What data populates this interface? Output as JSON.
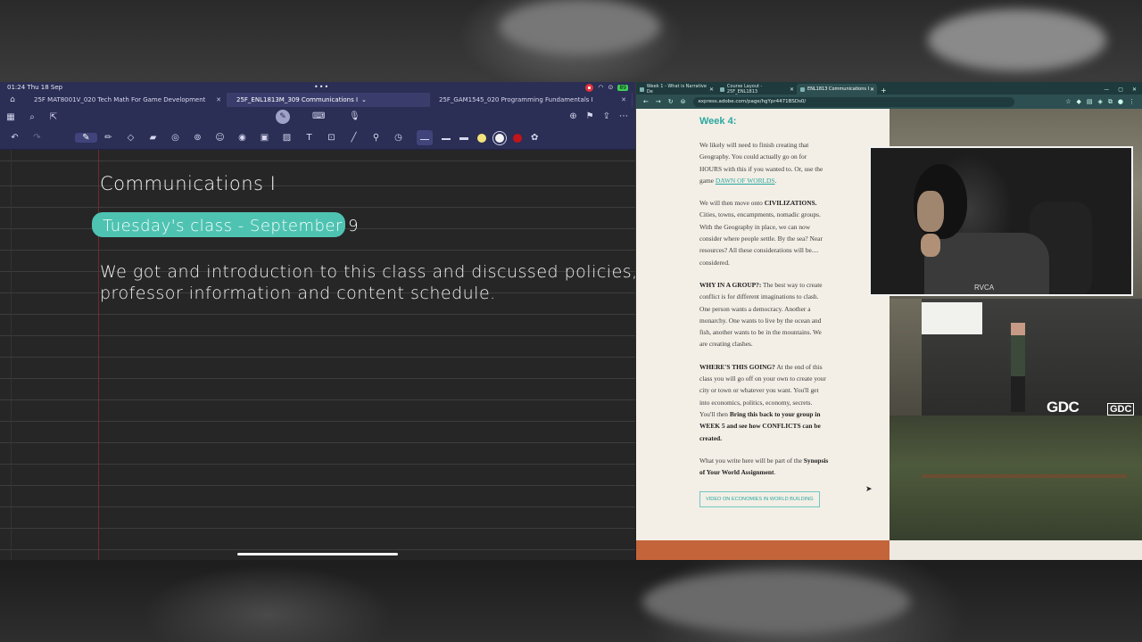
{
  "notes_app": {
    "status": {
      "time": "01:24",
      "date": "Thu 18 Sep",
      "battery": "89"
    },
    "tabs": [
      {
        "label": "25F MAT8001V_020 Tech Math For Game Development"
      },
      {
        "label": "25F_ENL1813M_309 Communications I"
      },
      {
        "label": "25F_GAM1545_020 Programming Fundamentals I"
      }
    ],
    "page": {
      "title": "Communications I",
      "highlight": "Tuesday's class - September 9",
      "body_line1": "We got and introduction to this class and discussed policies,",
      "body_line2": "professor information and content schedule."
    },
    "colors": {
      "highlight": "#4fc3b2",
      "yellow": "#f4e37a",
      "white": "#f2f2f2",
      "red": "#c2141b"
    }
  },
  "browser": {
    "tabs": [
      {
        "label": "Week 1 - What is Narrative De"
      },
      {
        "label": "Course Layout - 25F_ENL1813"
      },
      {
        "label": "ENL1813 Communications I"
      }
    ],
    "url": "express.adobe.com/page/hgYpr4471BSDs0/",
    "content": {
      "week": "Week 4:",
      "p1_text": "We likely will need to finish creating that Geography. You could actually go on for HOURS with this if you wanted to. Or, use the game ",
      "p1_link": "DAWN OF WORLDS",
      "p2_text": "We will then move onto ",
      "p2_bold": "CIVILIZATIONS.",
      "p2_rest": " Cities, towns, encampments, nomadic groups. With the Geography in place, we can now consider where people settle. By the sea? Near resources? All these considerations will be.... considered.",
      "p3_bold": "WHY IN A GROUP?:",
      "p3_rest": " The best way to create conflict is for different imaginations to clash. One person wants a democracy. Another a monarchy. One wants to live by the ocean and fish, another wants to be in the mountains. We are creating clashes.",
      "p4_bold": "WHERE'S THIS GOING?",
      "p4_rest": " At the end of this class you will go off on your own to create your city or town or whatever you want. You'll get into economics, politics, economy, secrets. You'll then ",
      "p4_bold2": "Bring this back to your group in WEEK 5 and see how CONFLICTS can be created.",
      "p5_text": "What you write here will be part of the ",
      "p5_bold": "Synopsis of Your World Assignment",
      "video_button": "VIDEO ON ECONOMIES IN WORLD BUILDING"
    },
    "gdc_logo": "GDC",
    "colors": {
      "accent": "#2aa7a0",
      "orange": "#c4643a"
    }
  },
  "webcam": {
    "shirt_logo": "RVCA"
  }
}
